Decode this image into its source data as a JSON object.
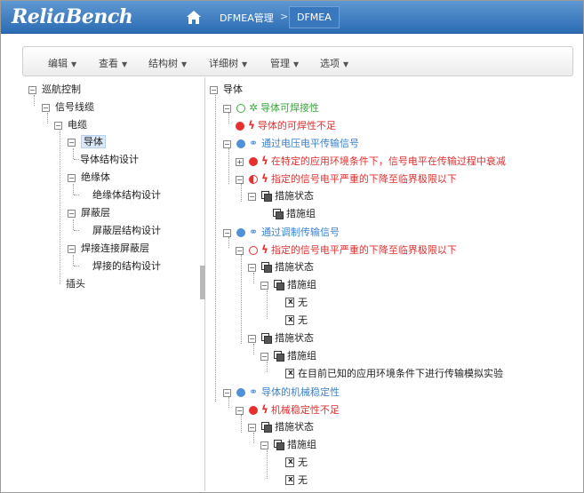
{
  "header": {
    "logo": "ReliaBench",
    "breadcrumbs": [
      "DFMEA管理",
      "DFMEA"
    ],
    "separator": ">"
  },
  "toolbar": {
    "menus": [
      "编辑",
      "查看",
      "结构树",
      "详细树",
      "管理",
      "选项"
    ]
  },
  "left_tree": [
    {
      "label": "巡航控制"
    },
    {
      "label": "信号线缆"
    },
    {
      "label": "电缆"
    },
    {
      "label": "导体",
      "selected": true
    },
    {
      "label": "导体结构设计"
    },
    {
      "label": "绝缘体"
    },
    {
      "label": "绝缘体结构设计"
    },
    {
      "label": "屏蔽层"
    },
    {
      "label": "屏蔽层结构设计"
    },
    {
      "label": "焊接连接屏蔽层"
    },
    {
      "label": "焊接的结构设计"
    },
    {
      "label": "插头"
    }
  ],
  "right_tree": [
    {
      "label": "导体"
    },
    {
      "label": "导体可焊接性"
    },
    {
      "label": "导体的可焊性不足"
    },
    {
      "label": "通过电压电平传输信号"
    },
    {
      "label": "在特定的应用环境条件下，信号电平在传输过程中衰减"
    },
    {
      "label": "指定的信号电平严重的下降至临界极限以下"
    },
    {
      "label": "措施状态"
    },
    {
      "label": "措施组"
    },
    {
      "label": "通过调制传输信号"
    },
    {
      "label": "指定的信号电平严重的下降至临界极限以下"
    },
    {
      "label": "措施状态"
    },
    {
      "label": "措施组"
    },
    {
      "label": "无"
    },
    {
      "label": "无"
    },
    {
      "label": "措施状态"
    },
    {
      "label": "措施组"
    },
    {
      "label": "在目前已知的应用环境条件下进行传输模拟实验"
    },
    {
      "label": "导体的机械稳定性"
    },
    {
      "label": "机械稳定性不足"
    },
    {
      "label": "措施状态"
    },
    {
      "label": "措施组"
    },
    {
      "label": "无"
    },
    {
      "label": "无"
    }
  ],
  "icons": {
    "home": "home-icon",
    "function": "gear-icon",
    "link": "link-icon",
    "failure": "lightning-icon",
    "action_status": "stack-icon",
    "action_none": "document-x-icon"
  },
  "colors": {
    "header": "#2b6cb4",
    "function_green": "#3aa63a",
    "failure_red": "#e03030",
    "function_blue": "#3a82cf"
  }
}
